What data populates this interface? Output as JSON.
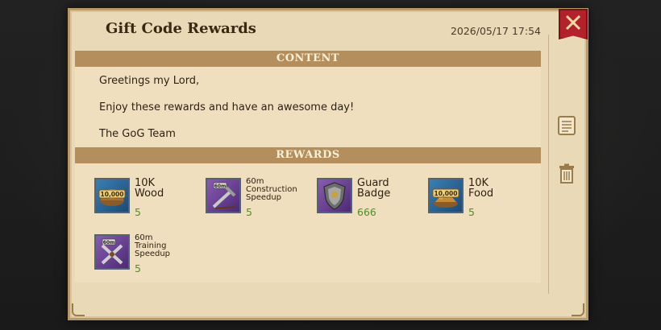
{
  "mail": {
    "title": "Gift Code Rewards",
    "timestamp": "2026/05/17 17:54",
    "content_header": "CONTENT",
    "message_lines": [
      "Greetings my Lord,",
      "Enjoy these rewards and have an awesome day!",
      "The GoG Team"
    ],
    "rewards_header": "REWARDS",
    "rewards": [
      {
        "name": "10K Wood",
        "qty": "5",
        "icon": "wood-icon",
        "badge": "10,000"
      },
      {
        "name": "60m Construction Speedup",
        "qty": "5",
        "icon": "construction-speedup-icon",
        "badge": "60m"
      },
      {
        "name": "Guard Badge",
        "qty": "666",
        "icon": "guard-badge-icon",
        "badge": ""
      },
      {
        "name": "10K Food",
        "qty": "5",
        "icon": "food-icon",
        "badge": "10,000"
      },
      {
        "name": "60m Training Speedup",
        "qty": "5",
        "icon": "training-speedup-icon",
        "badge": "60m"
      }
    ]
  },
  "controls": {
    "close": "close-icon",
    "note": "scroll-note-icon",
    "delete": "trash-icon"
  },
  "colors": {
    "parchment": "#ead9b7",
    "header_bar": "#b48e5c",
    "close_red": "#b3212a",
    "qty_green": "#4f8f26"
  }
}
